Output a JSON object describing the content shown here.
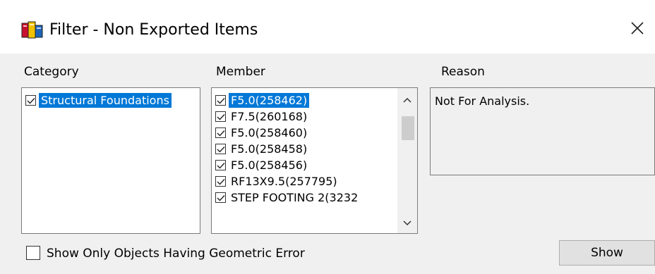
{
  "window": {
    "title": "Filter - Non Exported Items",
    "close_glyph": "✕"
  },
  "category": {
    "label": "Category",
    "items": [
      {
        "text": "Structural Foundations",
        "checked": true,
        "selected": true
      }
    ]
  },
  "member": {
    "label": "Member",
    "items": [
      {
        "text": "F5.0(258462)",
        "checked": true,
        "selected": true
      },
      {
        "text": "F7.5(260168)",
        "checked": true,
        "selected": false
      },
      {
        "text": "F5.0(258460)",
        "checked": true,
        "selected": false
      },
      {
        "text": "F5.0(258458)",
        "checked": true,
        "selected": false
      },
      {
        "text": "F5.0(258456)",
        "checked": true,
        "selected": false
      },
      {
        "text": "RF13X9.5(257795)",
        "checked": true,
        "selected": false
      },
      {
        "text": "STEP FOOTING 2(3232",
        "checked": true,
        "selected": false
      }
    ]
  },
  "reason": {
    "label": "Reason",
    "text": "Not For Analysis."
  },
  "footer": {
    "checkbox_label": "Show Only Objects Having Geometric Error",
    "checkbox_checked": false,
    "show_button": "Show"
  }
}
